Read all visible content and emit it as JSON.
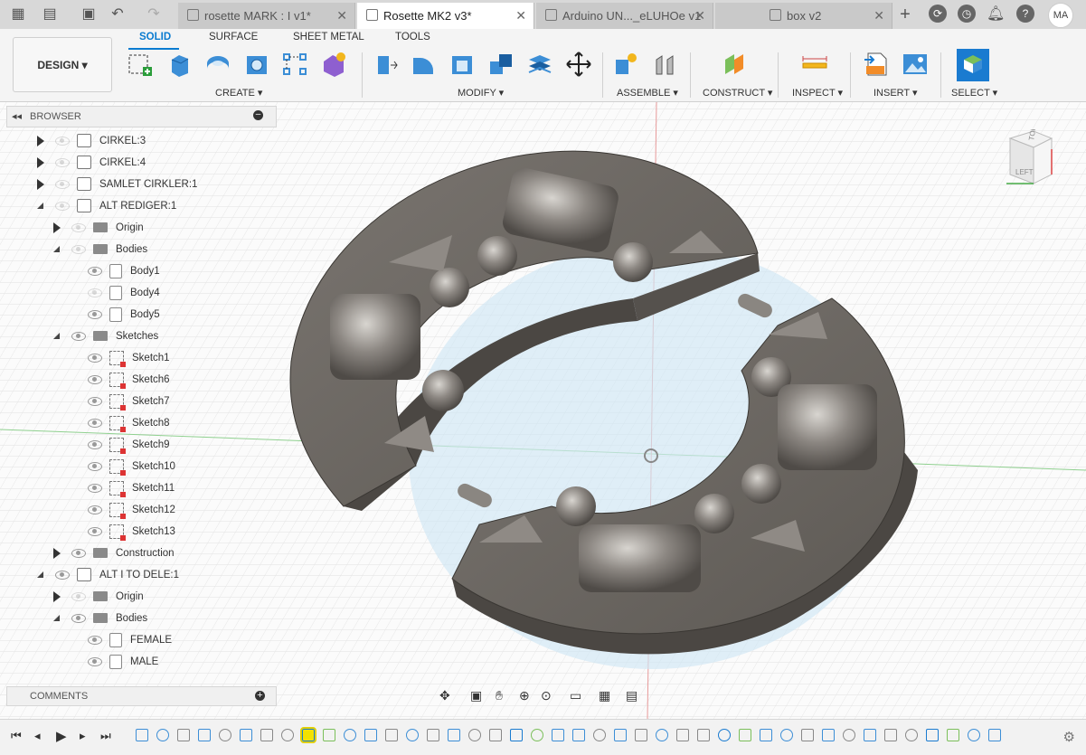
{
  "title_bar": {
    "tabs": [
      {
        "label": "rosette MARK : I v1*",
        "active": false
      },
      {
        "label": "Rosette MK2 v3*",
        "active": true
      },
      {
        "label": "Arduino UN..._eLUHOe v1",
        "active": false
      },
      {
        "label": "box v2",
        "active": false
      }
    ],
    "user_initials": "MA"
  },
  "toolbar": {
    "workspace": "DESIGN ▾",
    "tabs": [
      "SOLID",
      "SURFACE",
      "SHEET METAL",
      "TOOLS"
    ],
    "groups": [
      "CREATE ▾",
      "MODIFY ▾",
      "ASSEMBLE ▾",
      "CONSTRUCT ▾",
      "INSPECT ▾",
      "INSERT ▾",
      "SELECT ▾"
    ]
  },
  "browser": {
    "title": "BROWSER",
    "rows": [
      {
        "label": "CIRKEL:3",
        "level": 0,
        "type": "component",
        "expander": "closed",
        "visible": false
      },
      {
        "label": "CIRKEL:4",
        "level": 0,
        "type": "component",
        "expander": "closed",
        "visible": false
      },
      {
        "label": "SAMLET CIRKLER:1",
        "level": 0,
        "type": "component",
        "expander": "closed",
        "visible": false
      },
      {
        "label": "ALT REDIGER:1",
        "level": 0,
        "type": "component",
        "expander": "open",
        "visible": false
      },
      {
        "label": "Origin",
        "level": 1,
        "type": "folder",
        "expander": "closed",
        "visible": false
      },
      {
        "label": "Bodies",
        "level": 1,
        "type": "folder",
        "expander": "open",
        "visible": false
      },
      {
        "label": "Body1",
        "level": 2,
        "type": "body",
        "expander": "none",
        "visible": true
      },
      {
        "label": "Body4",
        "level": 2,
        "type": "body",
        "expander": "none",
        "visible": false
      },
      {
        "label": "Body5",
        "level": 2,
        "type": "body",
        "expander": "none",
        "visible": true
      },
      {
        "label": "Sketches",
        "level": 1,
        "type": "folder",
        "expander": "open",
        "visible": true
      },
      {
        "label": "Sketch1",
        "level": 2,
        "type": "sketch",
        "expander": "none",
        "visible": true
      },
      {
        "label": "Sketch6",
        "level": 2,
        "type": "sketch",
        "expander": "none",
        "visible": true
      },
      {
        "label": "Sketch7",
        "level": 2,
        "type": "sketch",
        "expander": "none",
        "visible": true
      },
      {
        "label": "Sketch8",
        "level": 2,
        "type": "sketch",
        "expander": "none",
        "visible": true
      },
      {
        "label": "Sketch9",
        "level": 2,
        "type": "sketch",
        "expander": "none",
        "visible": true
      },
      {
        "label": "Sketch10",
        "level": 2,
        "type": "sketch",
        "expander": "none",
        "visible": true
      },
      {
        "label": "Sketch11",
        "level": 2,
        "type": "sketch",
        "expander": "none",
        "visible": true
      },
      {
        "label": "Sketch12",
        "level": 2,
        "type": "sketch",
        "expander": "none",
        "visible": true
      },
      {
        "label": "Sketch13",
        "level": 2,
        "type": "sketch",
        "expander": "none",
        "visible": true
      },
      {
        "label": "Construction",
        "level": 1,
        "type": "folder",
        "expander": "closed",
        "visible": true
      },
      {
        "label": "ALT I TO DELE:1",
        "level": 0,
        "type": "component",
        "expander": "open",
        "visible": true
      },
      {
        "label": "Origin",
        "level": 1,
        "type": "folder",
        "expander": "closed",
        "visible": false
      },
      {
        "label": "Bodies",
        "level": 1,
        "type": "folder",
        "expander": "open",
        "visible": true
      },
      {
        "label": "FEMALE",
        "level": 2,
        "type": "body",
        "expander": "none",
        "visible": true
      },
      {
        "label": "MALE",
        "level": 2,
        "type": "body",
        "expander": "none",
        "visible": true
      }
    ]
  },
  "comments": {
    "title": "COMMENTS"
  },
  "viewcube": {
    "top": "TOP",
    "left": "LEFT"
  },
  "colors": {
    "accent": "#0a7bd0",
    "model": "#6d6863",
    "plane": "#cfe6f5"
  }
}
